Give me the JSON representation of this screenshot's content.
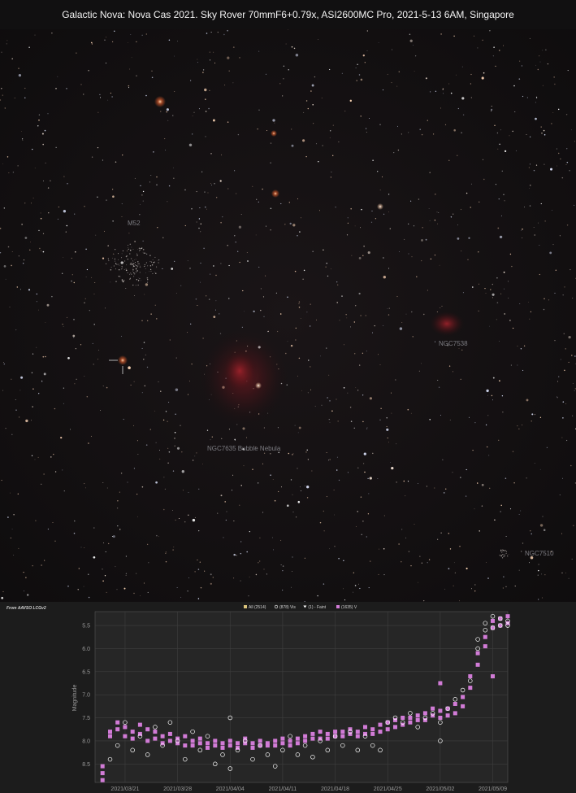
{
  "title": "Galactic Nova: Nova Cas 2021. Sky Rover 70mmF6+0.79x, ASI2600MC Pro, 2021-5-13 6AM, Singapore",
  "sky_labels": {
    "m52": "M52",
    "ngc7538": "NGC7538",
    "bubble": "NGC7635 Bubble Nebula",
    "ngc7510": "NGC7510"
  },
  "credit": "From AAVSO LCGv2",
  "legend": [
    {
      "label": "All (2514)",
      "icon": "square-icon",
      "color": "#d9c27a"
    },
    {
      "label": "Vis",
      "prefix": "(878)",
      "icon": "circle-icon",
      "color": "#ffffff"
    },
    {
      "label": "(1) - Faint",
      "icon": "triangle-down-icon",
      "color": "#ffffff"
    },
    {
      "label": "V",
      "prefix": "(1635)",
      "icon": "square-icon",
      "color": "#d17bd6"
    }
  ],
  "chart_data": {
    "type": "scatter",
    "ylabel": "Magnitude",
    "y_inverted": true,
    "ylim": [
      8.9,
      5.2
    ],
    "yticks": [
      "5.5",
      "6.0",
      "6.5",
      "7.0",
      "7.5",
      "8.0",
      "8.5"
    ],
    "xticks": [
      "2021/03/21",
      "2021/03/28",
      "2021/04/04",
      "2021/04/11",
      "2021/04/18",
      "2021/04/25",
      "2021/05/02",
      "2021/05/09"
    ],
    "xlim": [
      "2021/03/17",
      "2021/05/11"
    ],
    "grid": true,
    "series": [
      {
        "name": "V",
        "color": "#d17bd6",
        "points": [
          [
            "2021/03/18",
            8.85
          ],
          [
            "2021/03/18",
            8.7
          ],
          [
            "2021/03/18",
            8.55
          ],
          [
            "2021/03/19",
            7.9
          ],
          [
            "2021/03/19",
            7.8
          ],
          [
            "2021/03/20",
            7.6
          ],
          [
            "2021/03/20",
            7.75
          ],
          [
            "2021/03/21",
            7.9
          ],
          [
            "2021/03/21",
            7.7
          ],
          [
            "2021/03/22",
            7.8
          ],
          [
            "2021/03/22",
            7.95
          ],
          [
            "2021/03/23",
            7.65
          ],
          [
            "2021/03/23",
            7.85
          ],
          [
            "2021/03/24",
            7.75
          ],
          [
            "2021/03/24",
            8.0
          ],
          [
            "2021/03/25",
            7.8
          ],
          [
            "2021/03/25",
            7.95
          ],
          [
            "2021/03/26",
            7.9
          ],
          [
            "2021/03/26",
            8.05
          ],
          [
            "2021/03/27",
            7.85
          ],
          [
            "2021/03/27",
            8.0
          ],
          [
            "2021/03/28",
            7.95
          ],
          [
            "2021/03/28",
            8.05
          ],
          [
            "2021/03/29",
            7.9
          ],
          [
            "2021/03/29",
            8.1
          ],
          [
            "2021/03/30",
            8.0
          ],
          [
            "2021/03/30",
            8.1
          ],
          [
            "2021/03/31",
            7.95
          ],
          [
            "2021/03/31",
            8.05
          ],
          [
            "2021/04/01",
            8.05
          ],
          [
            "2021/04/01",
            8.15
          ],
          [
            "2021/04/02",
            8.0
          ],
          [
            "2021/04/02",
            8.1
          ],
          [
            "2021/04/03",
            8.05
          ],
          [
            "2021/04/03",
            8.15
          ],
          [
            "2021/04/04",
            8.0
          ],
          [
            "2021/04/04",
            8.1
          ],
          [
            "2021/04/05",
            8.05
          ],
          [
            "2021/04/05",
            8.15
          ],
          [
            "2021/04/06",
            7.95
          ],
          [
            "2021/04/06",
            8.05
          ],
          [
            "2021/04/07",
            8.05
          ],
          [
            "2021/04/07",
            8.15
          ],
          [
            "2021/04/08",
            8.0
          ],
          [
            "2021/04/08",
            8.1
          ],
          [
            "2021/04/09",
            8.05
          ],
          [
            "2021/04/09",
            8.1
          ],
          [
            "2021/04/10",
            8.0
          ],
          [
            "2021/04/10",
            8.1
          ],
          [
            "2021/04/11",
            7.95
          ],
          [
            "2021/04/11",
            8.05
          ],
          [
            "2021/04/12",
            8.0
          ],
          [
            "2021/04/12",
            8.1
          ],
          [
            "2021/04/13",
            7.95
          ],
          [
            "2021/04/13",
            8.05
          ],
          [
            "2021/04/14",
            7.9
          ],
          [
            "2021/04/14",
            8.0
          ],
          [
            "2021/04/15",
            7.85
          ],
          [
            "2021/04/15",
            7.95
          ],
          [
            "2021/04/16",
            7.8
          ],
          [
            "2021/04/16",
            7.95
          ],
          [
            "2021/04/17",
            7.85
          ],
          [
            "2021/04/17",
            7.95
          ],
          [
            "2021/04/18",
            7.8
          ],
          [
            "2021/04/18",
            7.9
          ],
          [
            "2021/04/19",
            7.8
          ],
          [
            "2021/04/19",
            7.9
          ],
          [
            "2021/04/20",
            7.75
          ],
          [
            "2021/04/20",
            7.85
          ],
          [
            "2021/04/21",
            7.8
          ],
          [
            "2021/04/21",
            7.9
          ],
          [
            "2021/04/22",
            7.7
          ],
          [
            "2021/04/22",
            7.85
          ],
          [
            "2021/04/23",
            7.75
          ],
          [
            "2021/04/23",
            7.85
          ],
          [
            "2021/04/24",
            7.65
          ],
          [
            "2021/04/24",
            7.8
          ],
          [
            "2021/04/25",
            7.6
          ],
          [
            "2021/04/25",
            7.75
          ],
          [
            "2021/04/26",
            7.55
          ],
          [
            "2021/04/26",
            7.7
          ],
          [
            "2021/04/27",
            7.5
          ],
          [
            "2021/04/27",
            7.65
          ],
          [
            "2021/04/28",
            7.5
          ],
          [
            "2021/04/28",
            7.6
          ],
          [
            "2021/04/29",
            7.45
          ],
          [
            "2021/04/29",
            7.55
          ],
          [
            "2021/04/30",
            7.4
          ],
          [
            "2021/04/30",
            7.55
          ],
          [
            "2021/05/01",
            7.45
          ],
          [
            "2021/05/01",
            7.3
          ],
          [
            "2021/05/02",
            7.35
          ],
          [
            "2021/05/02",
            7.5
          ],
          [
            "2021/05/03",
            7.3
          ],
          [
            "2021/05/03",
            7.45
          ],
          [
            "2021/05/04",
            7.2
          ],
          [
            "2021/05/04",
            7.4
          ],
          [
            "2021/05/05",
            7.05
          ],
          [
            "2021/05/05",
            7.25
          ],
          [
            "2021/05/06",
            6.6
          ],
          [
            "2021/05/06",
            6.85
          ],
          [
            "2021/05/07",
            6.1
          ],
          [
            "2021/05/07",
            6.35
          ],
          [
            "2021/05/08",
            5.75
          ],
          [
            "2021/05/08",
            5.95
          ],
          [
            "2021/05/09",
            5.4
          ],
          [
            "2021/05/09",
            5.55
          ],
          [
            "2021/05/10",
            5.35
          ],
          [
            "2021/05/10",
            5.5
          ],
          [
            "2021/05/11",
            5.3
          ],
          [
            "2021/05/11",
            5.45
          ],
          [
            "2021/05/02",
            6.75
          ],
          [
            "2021/05/09",
            6.6
          ]
        ]
      },
      {
        "name": "Vis",
        "color": "#ffffff",
        "points": [
          [
            "2021/03/19",
            8.4
          ],
          [
            "2021/03/20",
            8.1
          ],
          [
            "2021/03/21",
            7.6
          ],
          [
            "2021/03/22",
            8.2
          ],
          [
            "2021/03/23",
            7.9
          ],
          [
            "2021/03/24",
            8.3
          ],
          [
            "2021/03/25",
            7.7
          ],
          [
            "2021/03/26",
            8.1
          ],
          [
            "2021/03/27",
            7.6
          ],
          [
            "2021/03/28",
            8.0
          ],
          [
            "2021/03/29",
            8.4
          ],
          [
            "2021/03/30",
            7.8
          ],
          [
            "2021/03/31",
            8.2
          ],
          [
            "2021/04/01",
            7.9
          ],
          [
            "2021/04/02",
            8.5
          ],
          [
            "2021/04/03",
            8.3
          ],
          [
            "2021/04/04",
            8.6
          ],
          [
            "2021/04/04",
            7.5
          ],
          [
            "2021/04/05",
            8.2
          ],
          [
            "2021/04/06",
            8.0
          ],
          [
            "2021/04/07",
            8.4
          ],
          [
            "2021/04/08",
            8.1
          ],
          [
            "2021/04/09",
            8.3
          ],
          [
            "2021/04/10",
            8.55
          ],
          [
            "2021/04/11",
            8.2
          ],
          [
            "2021/04/12",
            7.9
          ],
          [
            "2021/04/13",
            8.3
          ],
          [
            "2021/04/14",
            8.1
          ],
          [
            "2021/04/15",
            8.35
          ],
          [
            "2021/04/16",
            8.0
          ],
          [
            "2021/04/17",
            8.2
          ],
          [
            "2021/04/18",
            7.9
          ],
          [
            "2021/04/19",
            8.1
          ],
          [
            "2021/04/20",
            7.8
          ],
          [
            "2021/04/21",
            8.2
          ],
          [
            "2021/04/22",
            7.9
          ],
          [
            "2021/04/23",
            8.1
          ],
          [
            "2021/04/24",
            8.2
          ],
          [
            "2021/04/25",
            7.6
          ],
          [
            "2021/04/26",
            7.5
          ],
          [
            "2021/04/27",
            7.6
          ],
          [
            "2021/04/28",
            7.4
          ],
          [
            "2021/04/29",
            7.7
          ],
          [
            "2021/04/30",
            7.5
          ],
          [
            "2021/05/01",
            7.4
          ],
          [
            "2021/05/02",
            7.6
          ],
          [
            "2021/05/02",
            8.0
          ],
          [
            "2021/05/03",
            7.3
          ],
          [
            "2021/05/04",
            7.1
          ],
          [
            "2021/05/05",
            6.9
          ],
          [
            "2021/05/06",
            6.7
          ],
          [
            "2021/05/07",
            6.0
          ],
          [
            "2021/05/07",
            5.8
          ],
          [
            "2021/05/08",
            5.6
          ],
          [
            "2021/05/08",
            5.45
          ],
          [
            "2021/05/09",
            5.3
          ],
          [
            "2021/05/09",
            5.55
          ],
          [
            "2021/05/10",
            5.35
          ],
          [
            "2021/05/10",
            5.5
          ],
          [
            "2021/05/11",
            5.4
          ],
          [
            "2021/05/11",
            5.5
          ]
        ]
      }
    ]
  }
}
